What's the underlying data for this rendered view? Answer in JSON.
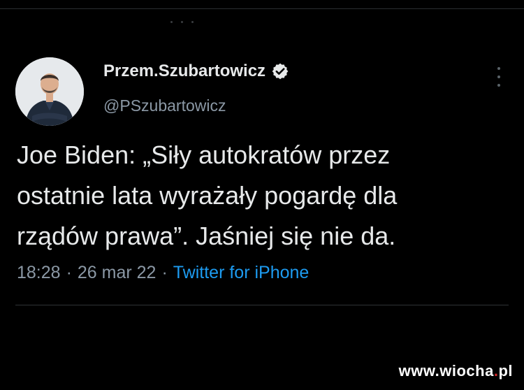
{
  "tweet": {
    "author": {
      "display_name": "Przem.Szubartowicz",
      "handle": "@PSzubartowicz",
      "verified": true,
      "avatar_icon": "person-photo-avatar"
    },
    "text_lines": [
      "Joe Biden: „Siły autokratów przez",
      "ostatnie lata wyrażały pogardę dla",
      "rządów prawa”. Jaśniej się nie da."
    ],
    "time": "18:28",
    "separator": "·",
    "date": "26 mar 22",
    "source": "Twitter for iPhone",
    "more_icon": "vertical-ellipsis-icon"
  },
  "watermark": {
    "prefix": "www.wiocha",
    "dot": ".",
    "suffix": "pl"
  },
  "colors": {
    "background": "#000000",
    "primary_text": "#e7e9ea",
    "secondary_text": "#8b98a5",
    "link": "#1d9bf0",
    "verified_badge": "#e7e9ea",
    "watermark_dot": "#d62828"
  }
}
